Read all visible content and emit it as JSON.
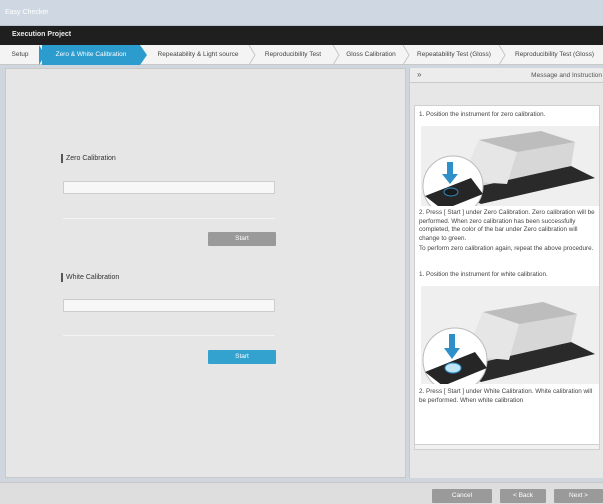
{
  "window": {
    "title": "Easy Checker"
  },
  "project_bar": {
    "title": "Execution Project"
  },
  "steps": [
    {
      "label": "Setup"
    },
    {
      "label": "Zero & White Calibration",
      "active": true
    },
    {
      "label": "Repeatability & Light source"
    },
    {
      "label": "Reproducibility Test"
    },
    {
      "label": "Gloss Calibration"
    },
    {
      "label": "Repeatability Test (Gloss)"
    },
    {
      "label": "Reproducibility Test (Gloss)"
    }
  ],
  "zero_calibration": {
    "label": "Zero Calibration",
    "button": "Start",
    "button_state": "disabled"
  },
  "white_calibration": {
    "label": "White Calibration",
    "button": "Start",
    "button_state": "enabled"
  },
  "panel": {
    "collapse_icon": "»",
    "title": "Message and Instruction",
    "zero_step1": "1. Position the instrument for zero calibration.",
    "zero_step2": "2. Press [ Start ] under Zero Calibration. Zero calibration will be performed. When zero calibration has been successfully completed, the color of the bar under Zero calibration will change to green.",
    "zero_repeat": "To perform zero calibration again, repeat the above procedure.",
    "white_step1": "1. Position the instrument for white calibration.",
    "white_step2": "2. Press [ Start ] under White Calibration. White calibration will be performed. When white calibration"
  },
  "footer": {
    "cancel": "Cancel",
    "back": "< Back",
    "next": "Next >"
  },
  "colors": {
    "accent": "#2b9ccd",
    "button_disabled": "#9a9a9a",
    "arrow": "#2f8fc9"
  }
}
